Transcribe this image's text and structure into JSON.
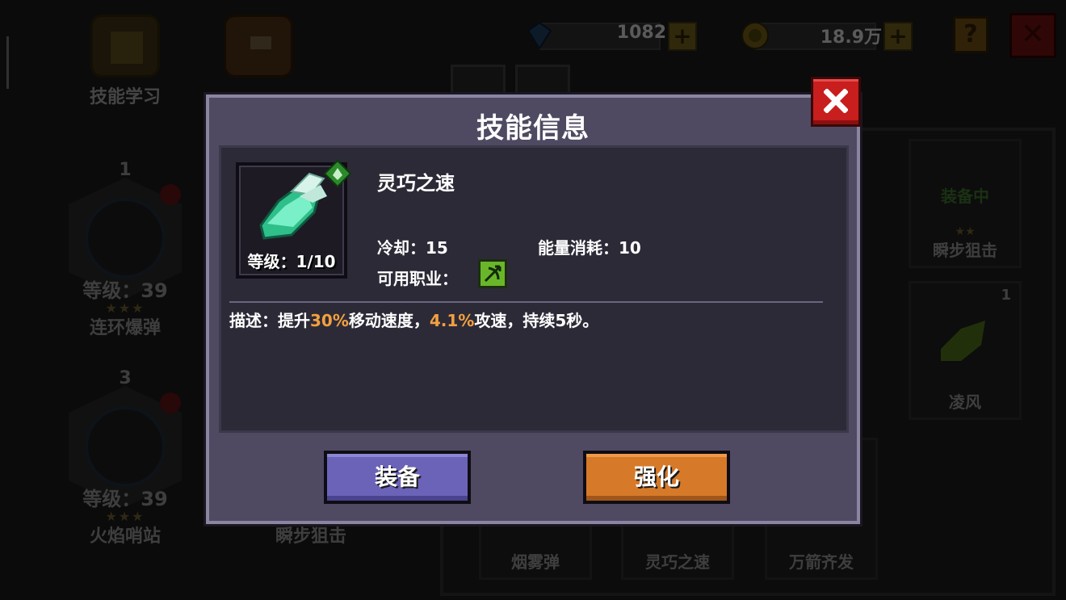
{
  "currency": {
    "gems": "1082",
    "coins": "18.9万",
    "gem_icon": "diamond-icon",
    "coin_icon": "coin-icon",
    "plus_symbol": "+"
  },
  "top_buttons": {
    "help": "?",
    "close": "✕"
  },
  "background_menu": {
    "skill_learning": "技能学习"
  },
  "background_skills": [
    {
      "order": "1",
      "level": "等级：39",
      "stars": "★★★",
      "name": "连环爆弹"
    },
    {
      "order": "3",
      "level": "等级：39",
      "stars": "★★★",
      "name": "火焰哨站"
    },
    {
      "name": "瞬步狙击"
    }
  ],
  "background_cards": [
    {
      "name": "瞬步狙击",
      "status": "装备中",
      "stars": "★★",
      "count": ""
    },
    {
      "name": "凌风",
      "count": "1"
    },
    {
      "name": "烟雾弹"
    },
    {
      "name": "灵巧之速"
    },
    {
      "name": "万箭齐发"
    }
  ],
  "modal": {
    "title": "技能信息",
    "skill": {
      "name": "灵巧之速",
      "level": "等级：1/10",
      "cooldown": "冷却：15",
      "energy_cost": "能量消耗：10",
      "class_label": "可用职业：",
      "icon": "winged-boot-icon",
      "element_icon": "leaf-element-icon",
      "class_icon": "archer-class-icon"
    },
    "description": {
      "prefix": "描述：提升",
      "value1": "30%",
      "mid": "移动速度，",
      "value2": "4.1%",
      "suffix": "攻速，持续5秒。"
    },
    "buttons": {
      "equip": "装备",
      "upgrade": "强化"
    }
  },
  "colors": {
    "modal_bg": "#4f4a62",
    "panel_bg": "#2d2a37",
    "highlight": "#f2a040",
    "equip_button": "#6b63b8",
    "upgrade_button": "#d67a2a",
    "close_button": "#c81e1e"
  }
}
